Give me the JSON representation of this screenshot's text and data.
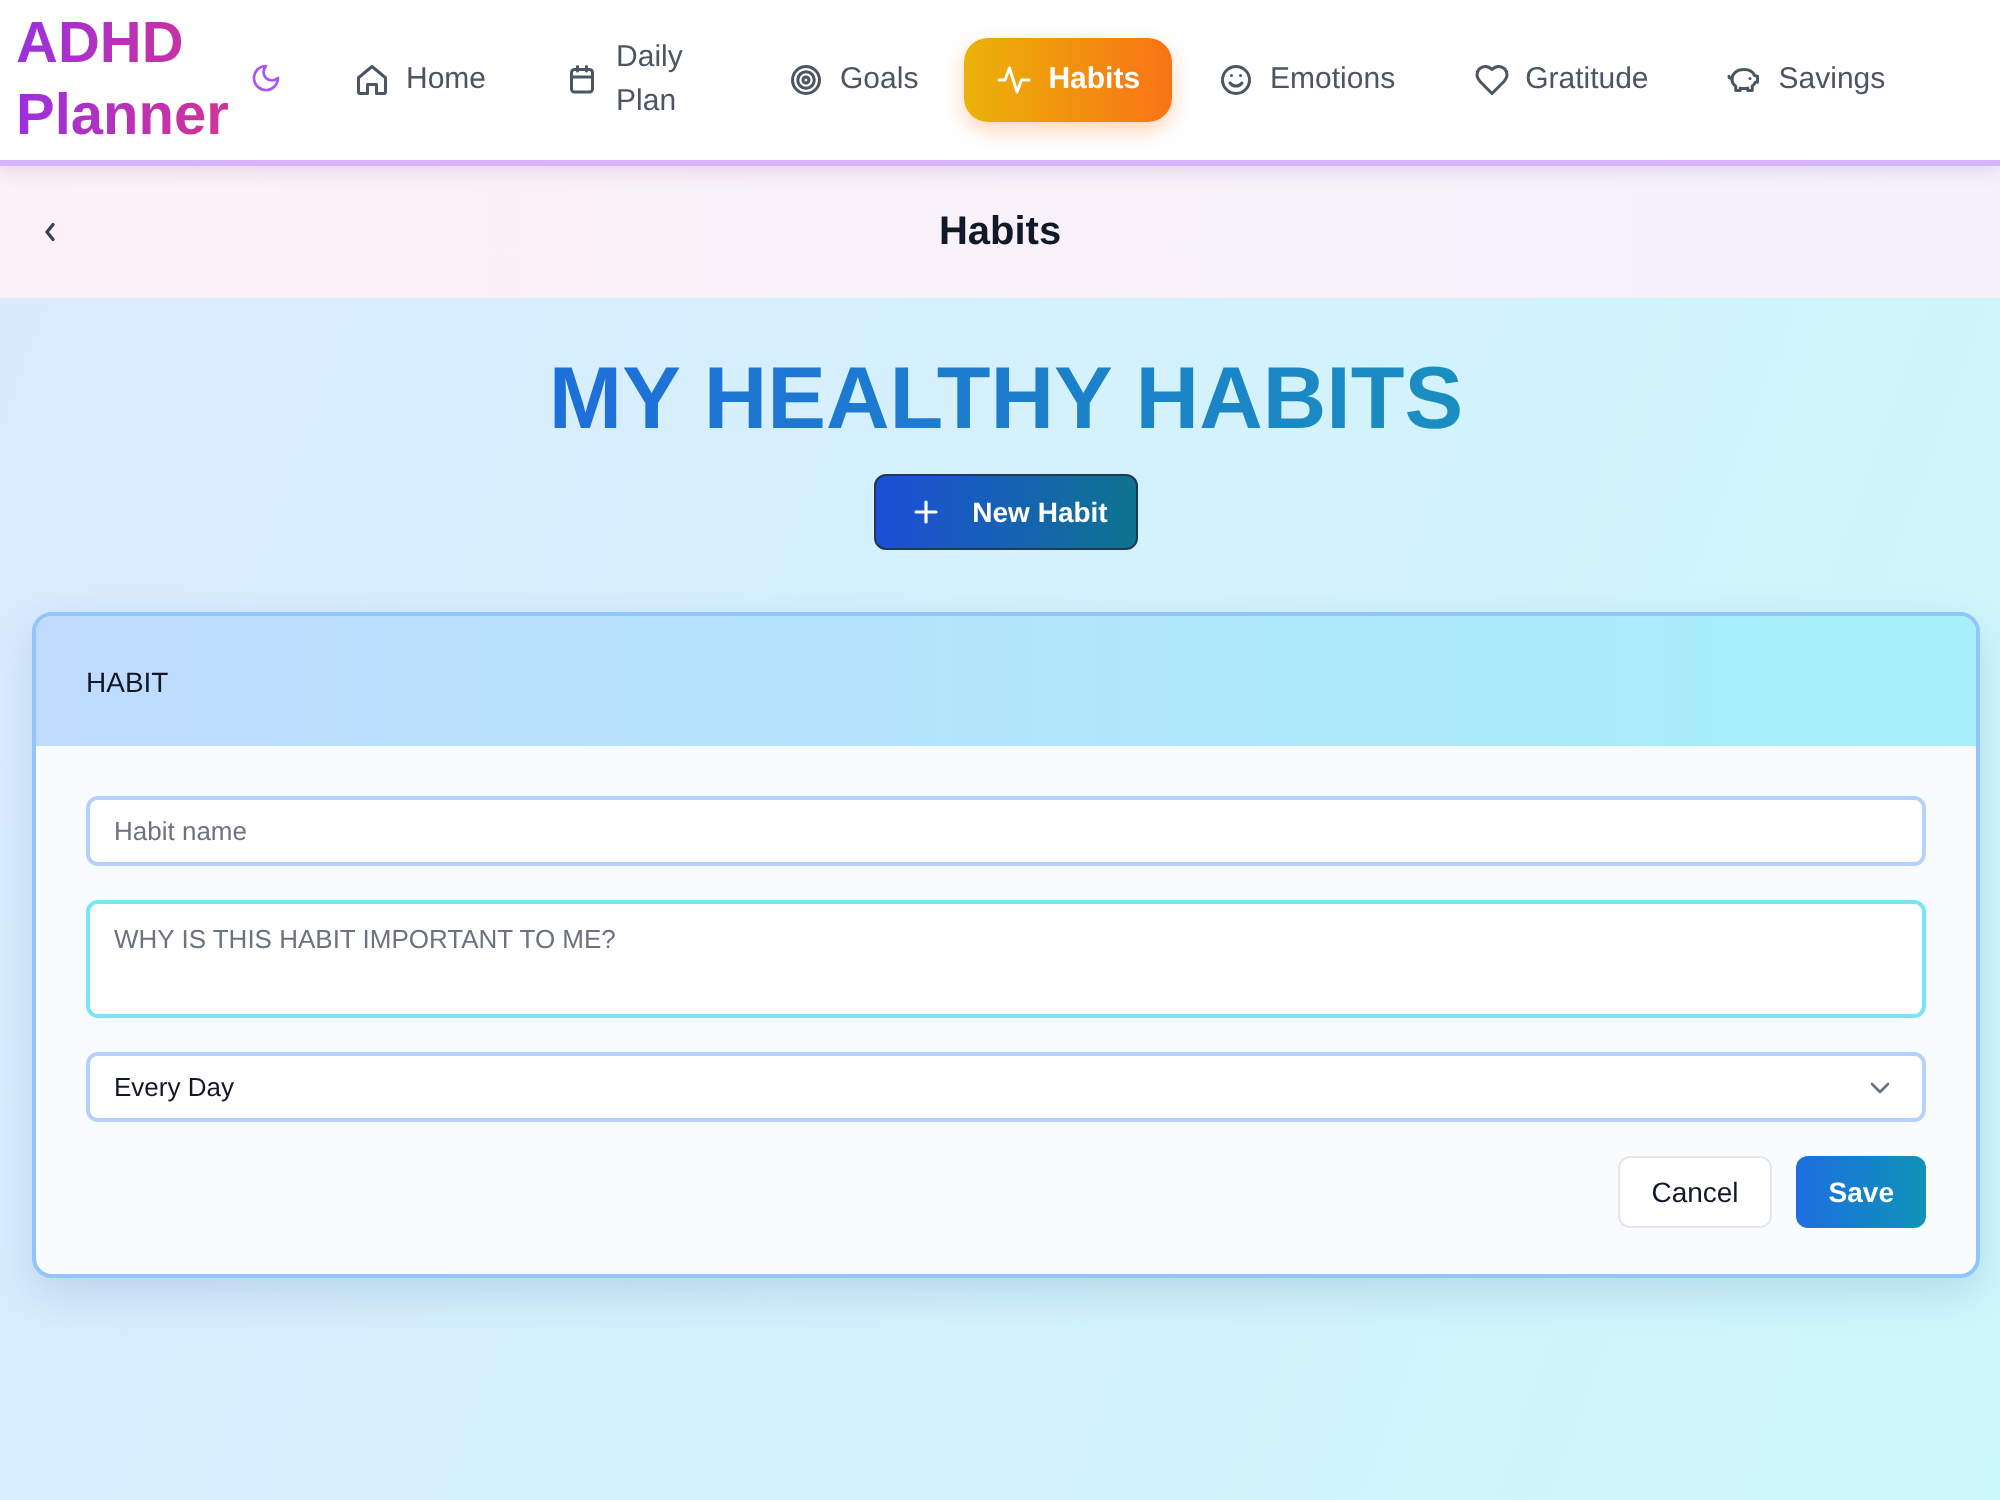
{
  "header": {
    "logo": "ADHD Planner",
    "nav": [
      {
        "label": "Home",
        "selected": false
      },
      {
        "label": "Daily Plan",
        "selected": false
      },
      {
        "label": "Goals",
        "selected": false
      },
      {
        "label": "Habits",
        "selected": true
      },
      {
        "label": "Emotions",
        "selected": false
      },
      {
        "label": "Gratitude",
        "selected": false
      },
      {
        "label": "Savings",
        "selected": false
      }
    ]
  },
  "page_header": {
    "title": "Habits"
  },
  "main": {
    "heading": "MY HEALTHY HABITS",
    "new_button": "New Habit"
  },
  "form": {
    "title": "HABIT",
    "name_field": {
      "placeholder": "Habit name"
    },
    "reason_field": {
      "placeholder": "WHY IS THIS HABIT IMPORTANT TO ME?"
    },
    "frequency_select": {
      "value": "Every Day"
    },
    "buttons": [
      {
        "label": "Cancel",
        "kind": "secondary"
      },
      {
        "label": "Save",
        "kind": "primary"
      }
    ]
  }
}
